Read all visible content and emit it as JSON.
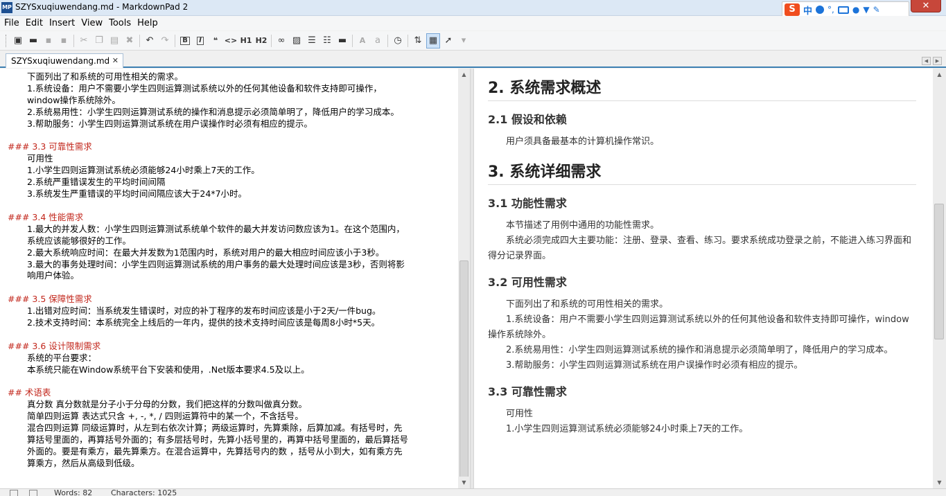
{
  "window": {
    "icon_text": "MP",
    "title": "SZYSxuqiuwendang.md - MarkdownPad 2",
    "close_glyph": "✕"
  },
  "ime": {
    "logo": "S",
    "mode": "中",
    "punct": "°,"
  },
  "menu": {
    "items": [
      "File",
      "Edit",
      "Insert",
      "View",
      "Tools",
      "Help"
    ]
  },
  "toolbar": {
    "bold": "B",
    "italic": "I",
    "quote": "❝",
    "code": "<>",
    "h1": "H1",
    "h2": "H2",
    "font_large": "A",
    "font_small": "a"
  },
  "tab": {
    "label": "SZYSxuqiuwendang.md",
    "close_glyph": "✕"
  },
  "editor": {
    "lines": [
      {
        "text": "下面列出了和系统的可用性相关的需求。",
        "kind": "in"
      },
      {
        "text": "1.系统设备：用户不需要小学生四则运算测试系统以外的任何其他设备和软件支持即可操作，",
        "kind": "in"
      },
      {
        "text": "window操作系统除外。",
        "kind": "in"
      },
      {
        "text": "2.系统易用性：小学生四则运算测试系统的操作和消息提示必须简单明了，降低用户的学习成本。",
        "kind": "in"
      },
      {
        "text": "3.帮助服务：小学生四则运算测试系统在用户误操作时必须有相应的提示。",
        "kind": "in"
      },
      {
        "text": "",
        "kind": "blank"
      },
      {
        "text": "### 3.3 可靠性需求",
        "kind": "h"
      },
      {
        "text": "可用性",
        "kind": "in"
      },
      {
        "text": "1.小学生四则运算测试系统必须能够24小时乘上7天的工作。",
        "kind": "in"
      },
      {
        "text": "2.系统严重错误发生的平均时间间隔",
        "kind": "in"
      },
      {
        "text": "3.系统发生严重错误的平均时间间隔应该大于24*7小时。",
        "kind": "in"
      },
      {
        "text": "",
        "kind": "blank"
      },
      {
        "text": "### 3.4 性能需求",
        "kind": "h"
      },
      {
        "text": "1.最大的并发人数：小学生四则运算测试系统单个软件的最大并发访问数应该为1。在这个范围内，",
        "kind": "in"
      },
      {
        "text": "系统应该能够很好的工作。",
        "kind": "in"
      },
      {
        "text": "2.最大系统响应时间：在最大并发数为1范围内时，系统对用户的最大相应时间应该小于3秒。",
        "kind": "in"
      },
      {
        "text": "3.最大的事务处理时间：小学生四则运算测试系统的用户事务的最大处理时间应该是3秒，否则将影",
        "kind": "in"
      },
      {
        "text": "响用户体验。",
        "kind": "in"
      },
      {
        "text": "",
        "kind": "blank"
      },
      {
        "text": "### 3.5 保障性需求",
        "kind": "h"
      },
      {
        "text": "1.出错对应时间：当系统发生错误时，对应的补丁程序的发布时间应该是小于2天/一件bug。",
        "kind": "in"
      },
      {
        "text": "2.技术支持时间：本系统完全上线后的一年内，提供的技术支持时间应该是每周8小时*5天。",
        "kind": "in"
      },
      {
        "text": "",
        "kind": "blank"
      },
      {
        "text": "### 3.6 设计限制需求",
        "kind": "h"
      },
      {
        "text": "系统的平台要求：",
        "kind": "in"
      },
      {
        "text": "本系统只能在Window系统平台下安装和使用，.Net版本要求4.5及以上。",
        "kind": "in"
      },
      {
        "text": "",
        "kind": "blank"
      },
      {
        "text": "## 术语表",
        "kind": "h"
      },
      {
        "text": "真分数    真分数就是分子小于分母的分数，我们把这样的分数叫做真分数。",
        "kind": "in"
      },
      {
        "text": "简单四则运算  表达式只含 +, -, *, / 四则运算符中的某一个，不含括号。",
        "kind": "in"
      },
      {
        "text": "混合四则运算  同级运算时，从左到右依次计算；两级运算时，先算乘除，后算加减。有括号时，先",
        "kind": "in"
      },
      {
        "text": "算括号里面的，再算括号外面的；有多层括号时，先算小括号里的，再算中括号里面的，最后算括号",
        "kind": "in"
      },
      {
        "text": "外面的。要是有乘方，最先算乘方。在混合运算中，先算括号内的数 ，括号从小到大，如有乘方先",
        "kind": "in"
      },
      {
        "text": "算乘方，然后从高级到低级。",
        "kind": "in"
      }
    ]
  },
  "preview": {
    "blocks": [
      {
        "type": "h2",
        "text": "2. 系统需求概述"
      },
      {
        "type": "gap",
        "text": ""
      },
      {
        "type": "h3",
        "text": "2.1 假设和依赖"
      },
      {
        "type": "p",
        "text": "用户须具备最基本的计算机操作常识。"
      },
      {
        "type": "gap",
        "text": ""
      },
      {
        "type": "h2",
        "text": "3. 系统详细需求"
      },
      {
        "type": "gap",
        "text": ""
      },
      {
        "type": "h3",
        "text": "3.1 功能性需求"
      },
      {
        "type": "p",
        "text": "本节描述了用例中通用的功能性需求。"
      },
      {
        "type": "p",
        "text": "系统必须完成四大主要功能：注册、登录、查看、练习。要求系统成功登录之前，不能进入练习界面和得分记录界面。"
      },
      {
        "type": "gap",
        "text": ""
      },
      {
        "type": "h3",
        "text": "3.2 可用性需求"
      },
      {
        "type": "p",
        "text": "下面列出了和系统的可用性相关的需求。"
      },
      {
        "type": "p",
        "text": "1.系统设备：用户不需要小学生四则运算测试系统以外的任何其他设备和软件支持即可操作，window操作系统除外。"
      },
      {
        "type": "p",
        "text": "2.系统易用性：小学生四则运算测试系统的操作和消息提示必须简单明了，降低用户的学习成本。"
      },
      {
        "type": "p",
        "text": "3.帮助服务：小学生四则运算测试系统在用户误操作时必须有相应的提示。"
      },
      {
        "type": "gap",
        "text": ""
      },
      {
        "type": "h3",
        "text": "3.3 可靠性需求"
      },
      {
        "type": "p",
        "text": "可用性"
      },
      {
        "type": "p",
        "text": "1.小学生四则运算测试系统必须能够24小时乘上7天的工作。"
      }
    ]
  },
  "status": {
    "words": "Words: 82",
    "characters": "Characters: 1025"
  }
}
